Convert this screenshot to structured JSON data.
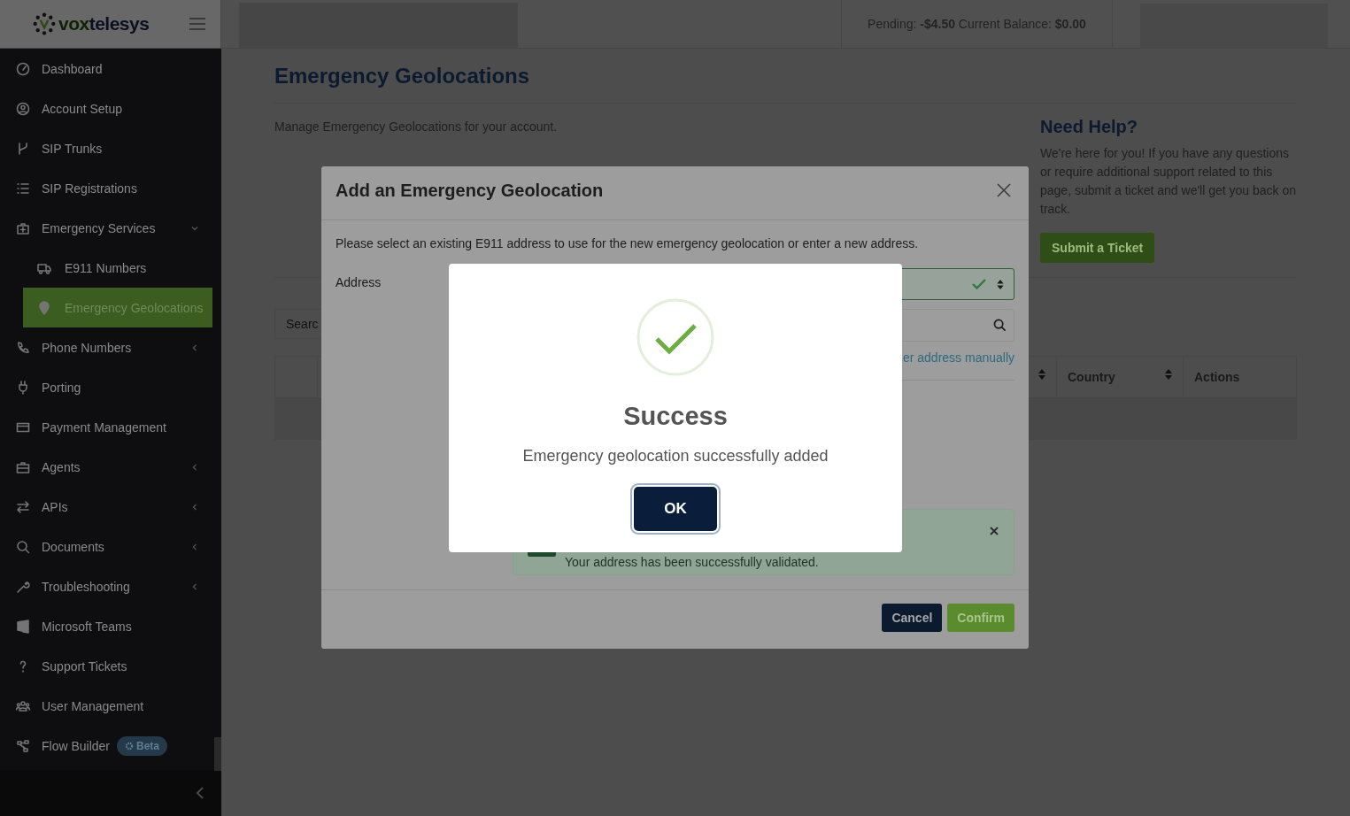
{
  "header": {
    "logo": {
      "part_1": "vox",
      "part_2": "telesys"
    },
    "balance": "Pending: **-$4.50** Current Balance: **$0.00**"
  },
  "sidebar": {
    "items": [
      {
        "label": "Dashboard",
        "selected": false
      },
      {
        "label": "Account Setup",
        "selected": false
      },
      {
        "label": "SIP Trunks",
        "selected": false
      },
      {
        "label": "SIP Registrations",
        "selected": false
      },
      {
        "label": "Emergency Services",
        "selected": false,
        "expanded": true,
        "children": [
          {
            "label": "E911 Numbers",
            "selected": false
          },
          {
            "label": "Emergency Geolocations",
            "selected": true
          }
        ]
      },
      {
        "label": "Phone Numbers",
        "selected": false,
        "expanded": false
      },
      {
        "label": "Porting",
        "selected": false
      },
      {
        "label": "Payment Management",
        "selected": false
      },
      {
        "label": "Agents",
        "selected": false,
        "expanded": false
      },
      {
        "label": "APIs",
        "selected": false,
        "expanded": false
      },
      {
        "label": "Documents",
        "selected": false,
        "expanded": false
      },
      {
        "label": "Troubleshooting",
        "selected": false,
        "expanded": false
      },
      {
        "label": "Microsoft Teams",
        "selected": false
      },
      {
        "label": "Support Tickets",
        "selected": false
      },
      {
        "label": "User Management",
        "selected": false
      },
      {
        "label": "Flow Builder",
        "selected": false,
        "badge": "Beta"
      }
    ]
  },
  "page": {
    "title": "Emergency Geolocations",
    "description": "Manage Emergency Geolocations for your account.",
    "search": {
      "placeholder": "Searc"
    },
    "table": {
      "columns": [
        {
          "sortable": true
        },
        {
          "label": "Country",
          "sortable": true
        },
        {
          "label": "Actions",
          "sortable": false
        }
      ]
    }
  },
  "help": {
    "title": "Need Help?",
    "text": "We're here for you! If you have any questions or require additional support related to this page, submit a ticket and we'll get you back on track.",
    "button": "Submit a Ticket"
  },
  "modal": {
    "title": "Add an Emergency Geolocation",
    "instruction": "Please select an existing E911 address to use for the new emergency geolocation or enter a new address.",
    "address_label": "Address",
    "select": {
      "valid": true
    },
    "link": "er address manually",
    "alert": {
      "text": "Your address has been successfully validated."
    },
    "buttons": [
      {
        "label": "Cancel",
        "kind": "secondary"
      },
      {
        "label": "Confirm",
        "kind": "primary"
      }
    ]
  },
  "success": {
    "title": "Success",
    "message": "Emergency geolocation successfully added",
    "button": "OK"
  }
}
